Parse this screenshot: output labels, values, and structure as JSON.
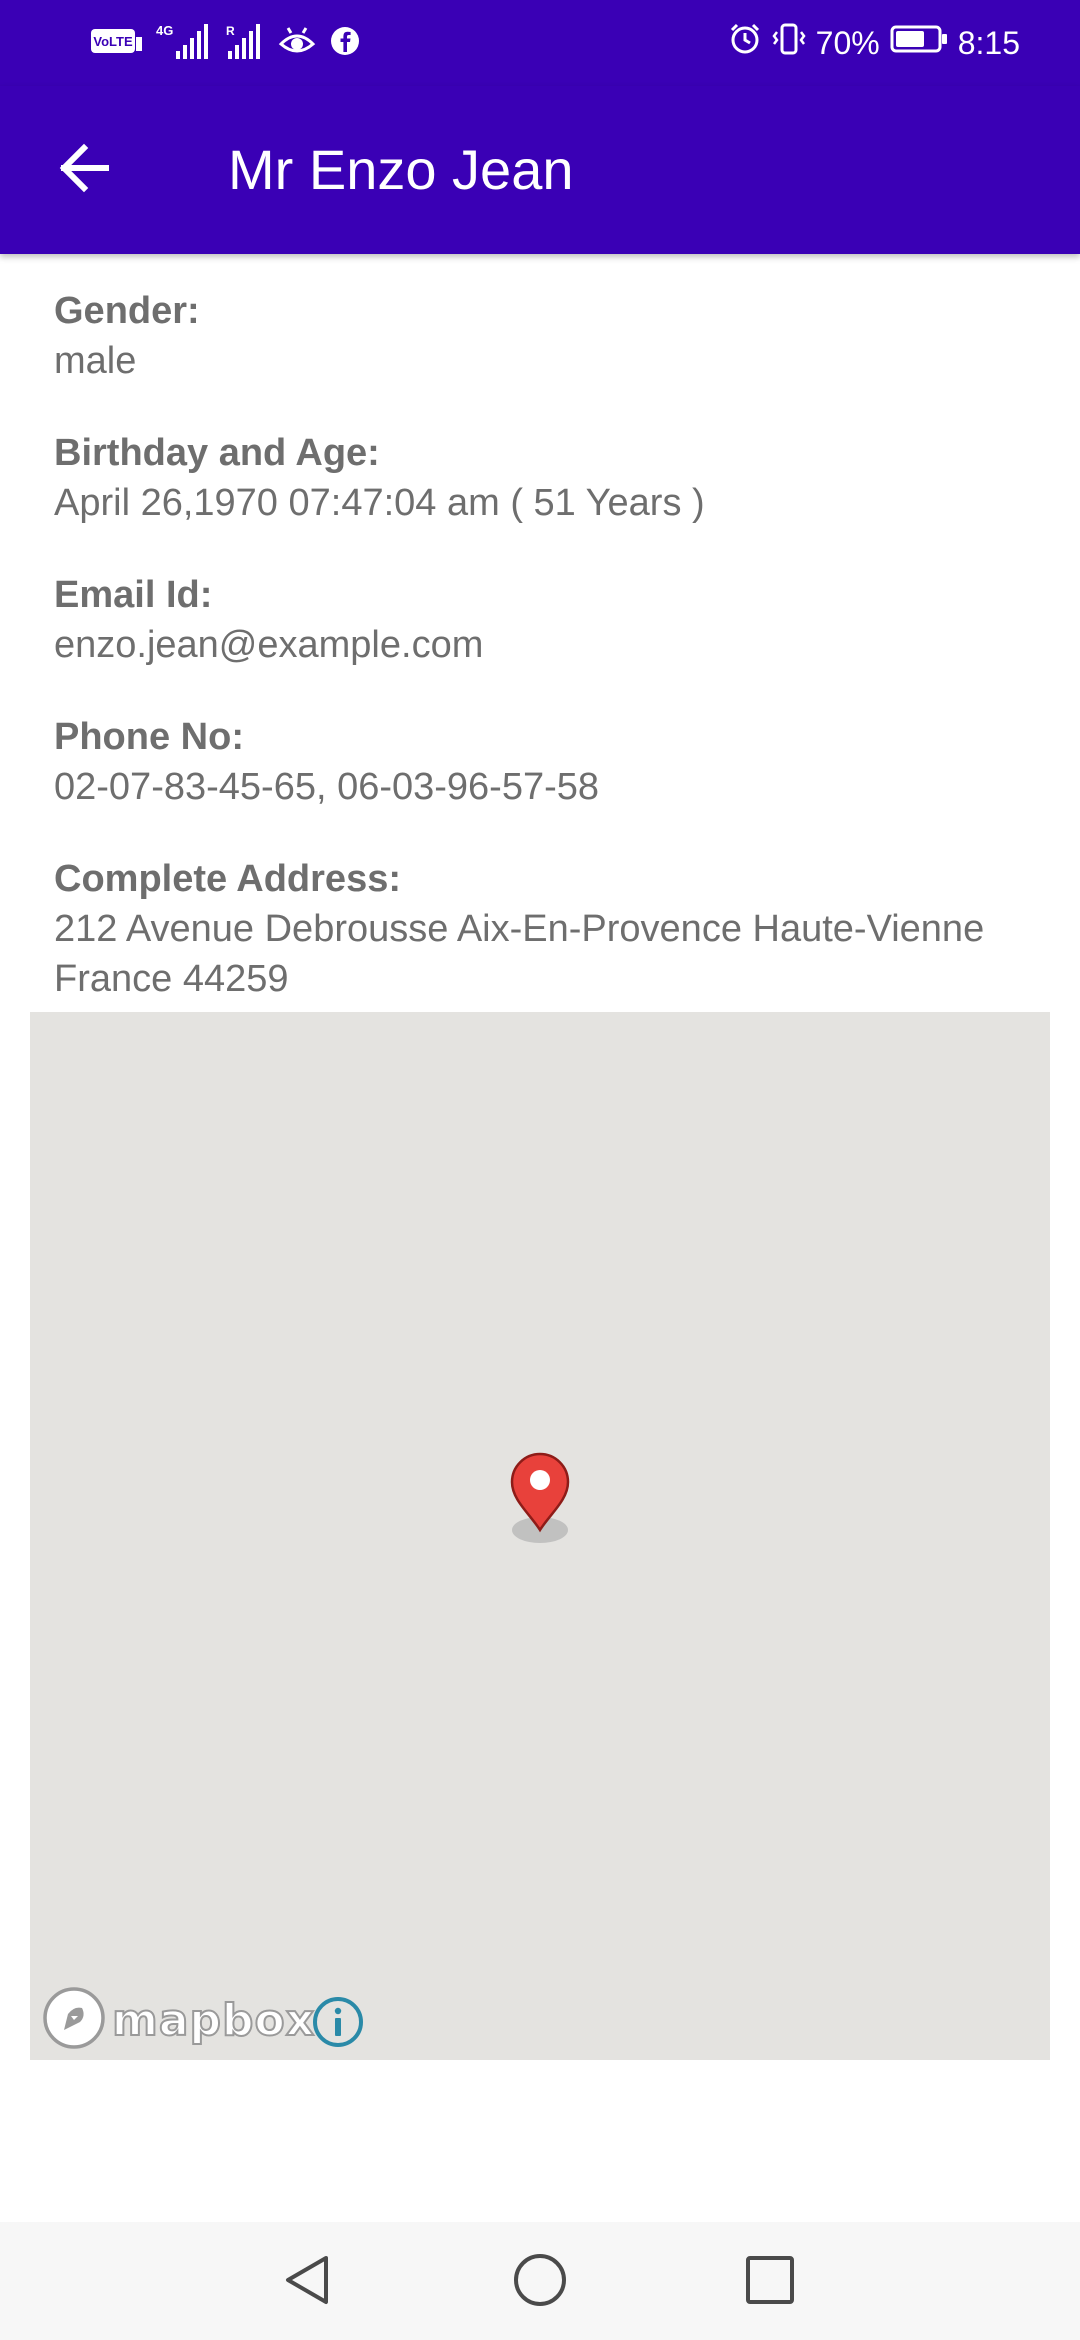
{
  "status_bar": {
    "left_icons": [
      "volte-icon",
      "4g-signal-icon",
      "roaming-signal-icon",
      "eye-icon",
      "facebook-icon"
    ],
    "volte_text": "VoLTE",
    "network_text": "4G",
    "roaming_text": "R",
    "battery_percent": "70%",
    "time": "8:15",
    "battery_level": 0.7
  },
  "app_bar": {
    "title": "Mr Enzo Jean",
    "back_icon": "arrow-left-icon"
  },
  "details": {
    "gender_label": "Gender:",
    "gender_value": "male",
    "birthday_label": "Birthday and Age:",
    "birthday_value": "April 26,1970 07:47:04 am ( 51 Years )",
    "email_label": "Email Id:",
    "email_value": "enzo.jean@example.com",
    "phone_label": "Phone No:",
    "phone_value": "02-07-83-45-65, 06-03-96-57-58",
    "address_label": "Complete Address:",
    "address_line1": "212 Avenue Debrousse Aix-En-Provence Haute-Vienne",
    "address_line2": "France 44259"
  },
  "map": {
    "attribution_text": "mapbox",
    "pin_icon": "map-pin-icon",
    "info_icon": "info-icon"
  },
  "nav_bar": {
    "back_icon": "triangle-back-icon",
    "home_icon": "circle-home-icon",
    "recents_icon": "square-recents-icon"
  },
  "colors": {
    "primary": "#3a00b5",
    "text": "#6e6e6e",
    "map_bg": "#e4e3e0",
    "pin": "#e8413b",
    "info": "#2a8aa8"
  }
}
